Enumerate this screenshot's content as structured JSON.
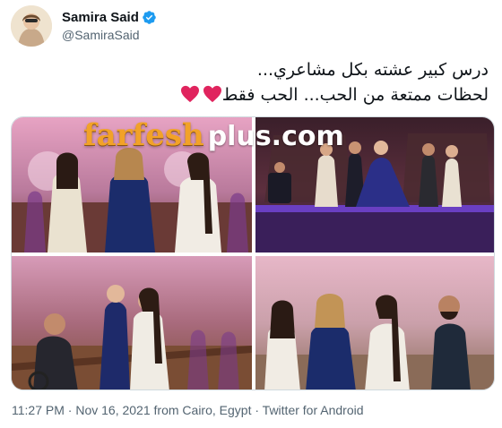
{
  "author": {
    "display_name": "Samira Said",
    "handle": "@SamiraSaid",
    "verified": true,
    "accent_color": "#1d9bf0"
  },
  "tweet": {
    "line1": "درس كبير عشته بكل مشاعري...",
    "line2": "لحظات ممتعة من الحب... الحب فقط",
    "heart_icon": "red-heart-emoji",
    "heart_color": "#e0245e"
  },
  "media": {
    "watermark_brand": "farfesh",
    "watermark_suffix": "plus.com",
    "photo_count": 4
  },
  "footer": {
    "time": "11:27 PM",
    "date": "Nov 16, 2021",
    "location": "from Cairo, Egypt",
    "client": "Twitter for Android",
    "separator": "·"
  }
}
